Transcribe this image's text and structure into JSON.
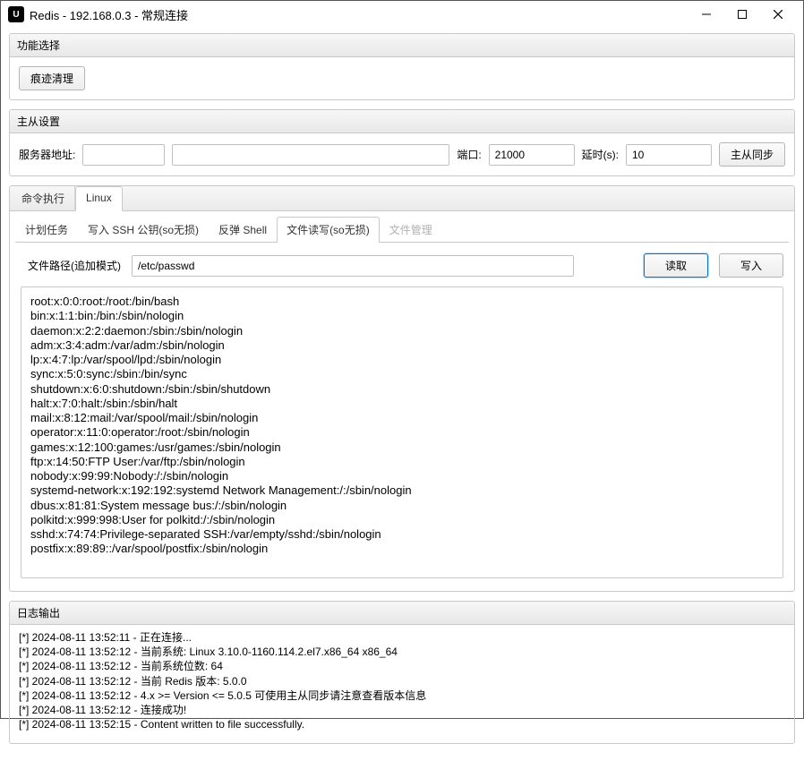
{
  "window": {
    "title": "Redis - 192.168.0.3 - 常规连接"
  },
  "function_panel": {
    "title": "功能选择",
    "clear_btn": "痕迹清理"
  },
  "master_slave": {
    "title": "主从设置",
    "server_label": "服务器地址:",
    "server_value": "",
    "port_label": "端口:",
    "port_value": "21000",
    "delay_label": "延时(s):",
    "delay_value": "10",
    "sync_btn": "主从同步"
  },
  "tabs": {
    "cmd": "命令执行",
    "linux": "Linux"
  },
  "subtabs": {
    "cron": "计划任务",
    "ssh": "写入 SSH 公钥(so无损)",
    "rshell": "反弹 Shell",
    "rw": "文件读写(so无损)",
    "fm": "文件管理"
  },
  "file": {
    "label": "文件路径(追加模式)",
    "path": "/etc/passwd",
    "read_btn": "读取",
    "write_btn": "写入"
  },
  "file_content": "root:x:0:0:root:/root:/bin/bash\nbin:x:1:1:bin:/bin:/sbin/nologin\ndaemon:x:2:2:daemon:/sbin:/sbin/nologin\nadm:x:3:4:adm:/var/adm:/sbin/nologin\nlp:x:4:7:lp:/var/spool/lpd:/sbin/nologin\nsync:x:5:0:sync:/sbin:/bin/sync\nshutdown:x:6:0:shutdown:/sbin:/sbin/shutdown\nhalt:x:7:0:halt:/sbin:/sbin/halt\nmail:x:8:12:mail:/var/spool/mail:/sbin/nologin\noperator:x:11:0:operator:/root:/sbin/nologin\ngames:x:12:100:games:/usr/games:/sbin/nologin\nftp:x:14:50:FTP User:/var/ftp:/sbin/nologin\nnobody:x:99:99:Nobody:/:/sbin/nologin\nsystemd-network:x:192:192:systemd Network Management:/:/sbin/nologin\ndbus:x:81:81:System message bus:/:/sbin/nologin\npolkitd:x:999:998:User for polkitd:/:/sbin/nologin\nsshd:x:74:74:Privilege-separated SSH:/var/empty/sshd:/sbin/nologin\npostfix:x:89:89::/var/spool/postfix:/sbin/nologin",
  "log": {
    "title": "日志输出",
    "lines": "[*] 2024-08-11 13:52:11 - 正在连接...\n[*] 2024-08-11 13:52:12 - 当前系统: Linux 3.10.0-1160.114.2.el7.x86_64 x86_64\n[*] 2024-08-11 13:52:12 - 当前系统位数: 64\n[*] 2024-08-11 13:52:12 - 当前 Redis 版本: 5.0.0\n[*] 2024-08-11 13:52:12 - 4.x >= Version <= 5.0.5 可使用主从同步请注意查看版本信息\n[*] 2024-08-11 13:52:12 - 连接成功!\n[*] 2024-08-11 13:52:15 - Content written to file successfully."
  }
}
